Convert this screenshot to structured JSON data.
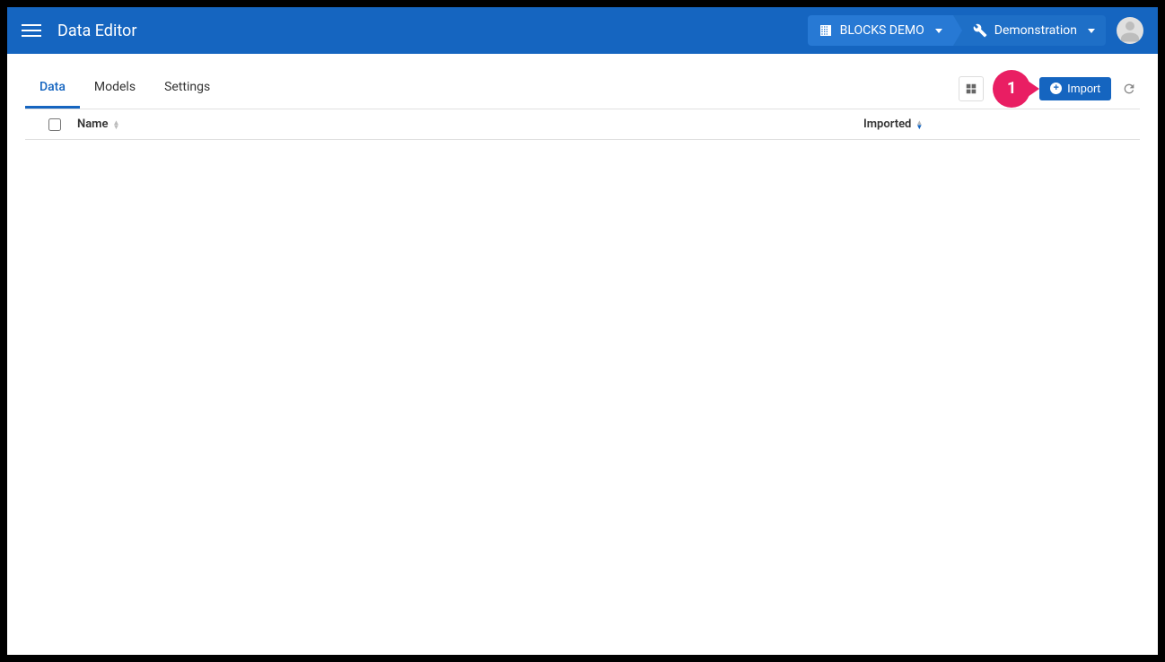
{
  "header": {
    "app_title": "Data Editor",
    "crumb1_label": "BLOCKS DEMO",
    "crumb2_label": "Demonstration"
  },
  "toolbar": {
    "tabs": [
      {
        "label": "Data",
        "active": true
      },
      {
        "label": "Models",
        "active": false
      },
      {
        "label": "Settings",
        "active": false
      }
    ],
    "annotation_number": "1",
    "import_label": "Import"
  },
  "table": {
    "columns": {
      "name": "Name",
      "imported": "Imported"
    },
    "rows": []
  }
}
